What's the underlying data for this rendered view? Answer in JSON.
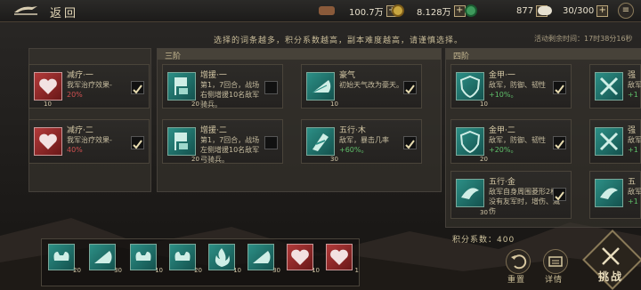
{
  "header": {
    "back_label": "返回",
    "resources": [
      {
        "name": "wood",
        "value": "100.7万"
      },
      {
        "name": "copper-coin",
        "value": "8.128万"
      },
      {
        "name": "jade",
        "value": "877"
      },
      {
        "name": "grain",
        "value": "30/300"
      }
    ],
    "menu_icon": "≡"
  },
  "notice": "选择的词条越多，积分系数越高，副本难度越高，请谨慎选择。",
  "timer": "活动剩余时间：17时38分16秒",
  "columns": [
    {
      "title": ""
    },
    {
      "title": "三阶"
    },
    {
      "title": "四阶"
    }
  ],
  "cards": [
    {
      "title": "减疗·一",
      "desc": "我军治疗效果-",
      "value": "20%",
      "level": "10",
      "checked": true
    },
    {
      "title": "减疗·二",
      "desc": "我军治疗效果-",
      "value": "40%",
      "level": "",
      "checked": true
    },
    {
      "title": "增援·一",
      "desc": "第1，7回合，战场右侧增援10名敌军骑兵。",
      "level": "20",
      "checked": false
    },
    {
      "title": "增援·二",
      "desc": "第1，7回合，战场左侧增援10名敌军弓骑兵。",
      "level": "20",
      "checked": false
    },
    {
      "title": "豪气",
      "desc": "初始天气改为豪天。",
      "level": "10",
      "checked": true
    },
    {
      "title": "五行·木",
      "desc": "敌军，暴击几率",
      "value": "+60%。",
      "level": "30",
      "checked": true
    },
    {
      "title": "金甲·一",
      "desc": "敌军，防御、韧性",
      "value": "+10%。",
      "level": "10",
      "checked": true
    },
    {
      "title": "金甲·二",
      "desc": "敌军，防御、韧性",
      "value": "+20%。",
      "level": "20",
      "checked": true
    },
    {
      "title": "五行·金",
      "desc": "敌军自身周围菱形2格没有友军时，增伤、减伤",
      "level": "30",
      "checked": true
    },
    {
      "title": "强",
      "desc": "敌军",
      "value": "+1",
      "level": "",
      "checked": false
    },
    {
      "title": "强",
      "desc": "敌军",
      "value": "+1",
      "level": "",
      "checked": false
    },
    {
      "title": "五",
      "desc": "敌军",
      "value": "+1",
      "level": "",
      "checked": false
    }
  ],
  "slots": [
    {
      "icon": "muscle-icon",
      "level": "20"
    },
    {
      "icon": "fan-icon",
      "level": "30"
    },
    {
      "icon": "muscle-icon",
      "level": "10"
    },
    {
      "icon": "muscle-icon",
      "level": "20"
    },
    {
      "icon": "flame-icon",
      "level": "10"
    },
    {
      "icon": "fan-icon",
      "level": "30"
    },
    {
      "icon": "heart-icon",
      "level": "10"
    },
    {
      "icon": "heart-icon",
      "level": "1"
    }
  ],
  "score_label": "积分系数：400",
  "actions": {
    "reset": "重置",
    "detail": "详情",
    "fight": "挑战"
  }
}
